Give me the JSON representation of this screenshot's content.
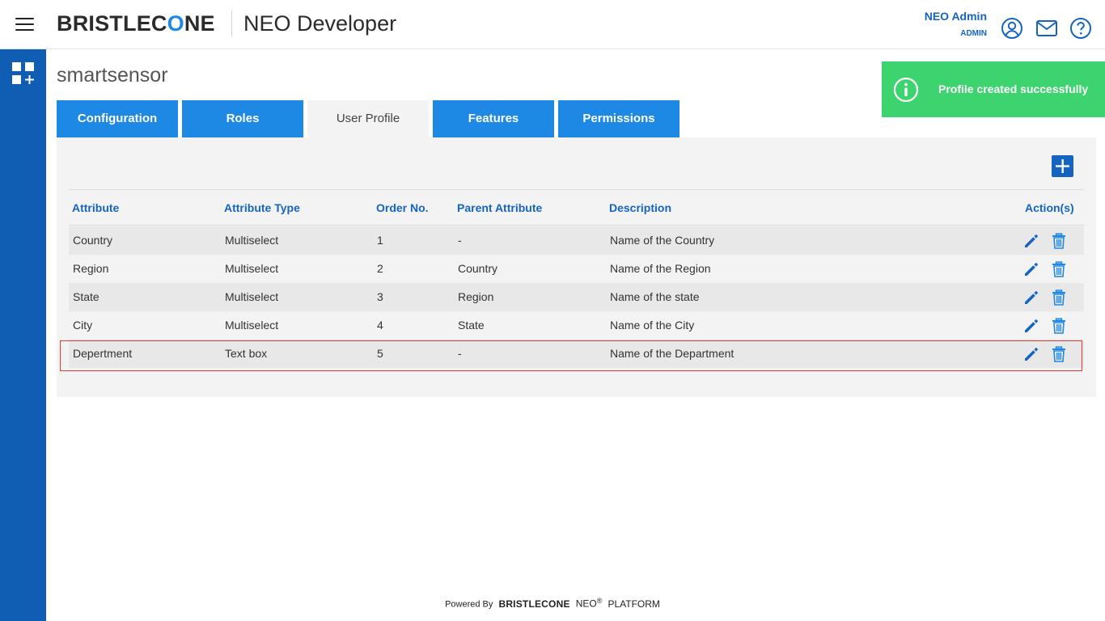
{
  "header": {
    "brand": "BRISTLEC",
    "brand_o": "O",
    "brand_tail": "NE",
    "app_title": "NEO Developer",
    "user_name": "NEO Admin",
    "user_role": "ADMIN",
    "icons": [
      "account-circle-icon",
      "mail-icon",
      "help-icon"
    ]
  },
  "sidebar": {
    "icon": "apps-add-icon"
  },
  "page": {
    "title": "smartsensor"
  },
  "tabs": [
    {
      "label": "Configuration",
      "active": false
    },
    {
      "label": "Roles",
      "active": false
    },
    {
      "label": "User Profile",
      "active": true
    },
    {
      "label": "Features",
      "active": false
    },
    {
      "label": "Permissions",
      "active": false
    }
  ],
  "table": {
    "columns": [
      "Attribute",
      "Attribute Type",
      "Order No.",
      "Parent Attribute",
      "Description",
      "Action(s)"
    ],
    "rows": [
      {
        "attribute": "Country",
        "type": "Multiselect",
        "order": "1",
        "parent": "-",
        "description": "Name of the Country"
      },
      {
        "attribute": "Region",
        "type": "Multiselect",
        "order": "2",
        "parent": "Country",
        "description": "Name of the Region"
      },
      {
        "attribute": "State",
        "type": "Multiselect",
        "order": "3",
        "parent": "Region",
        "description": "Name of the state"
      },
      {
        "attribute": "City",
        "type": "Multiselect",
        "order": "4",
        "parent": "State",
        "description": "Name of the City"
      },
      {
        "attribute": "Depertment",
        "type": "Text box",
        "order": "5",
        "parent": "-",
        "description": "Name of the Department"
      }
    ]
  },
  "toast": {
    "message": "Profile created successfully",
    "icon": "info-icon",
    "color": "#3dd36e"
  },
  "footer": {
    "powered_by": "Powered By",
    "brand": "BRISTLECONE",
    "neo": "NEO",
    "reg": "®",
    "platform": "PLATFORM"
  },
  "colors": {
    "primary": "#1e88e5",
    "sidebar": "#0f5eb4",
    "header_text": "#1565c0"
  }
}
